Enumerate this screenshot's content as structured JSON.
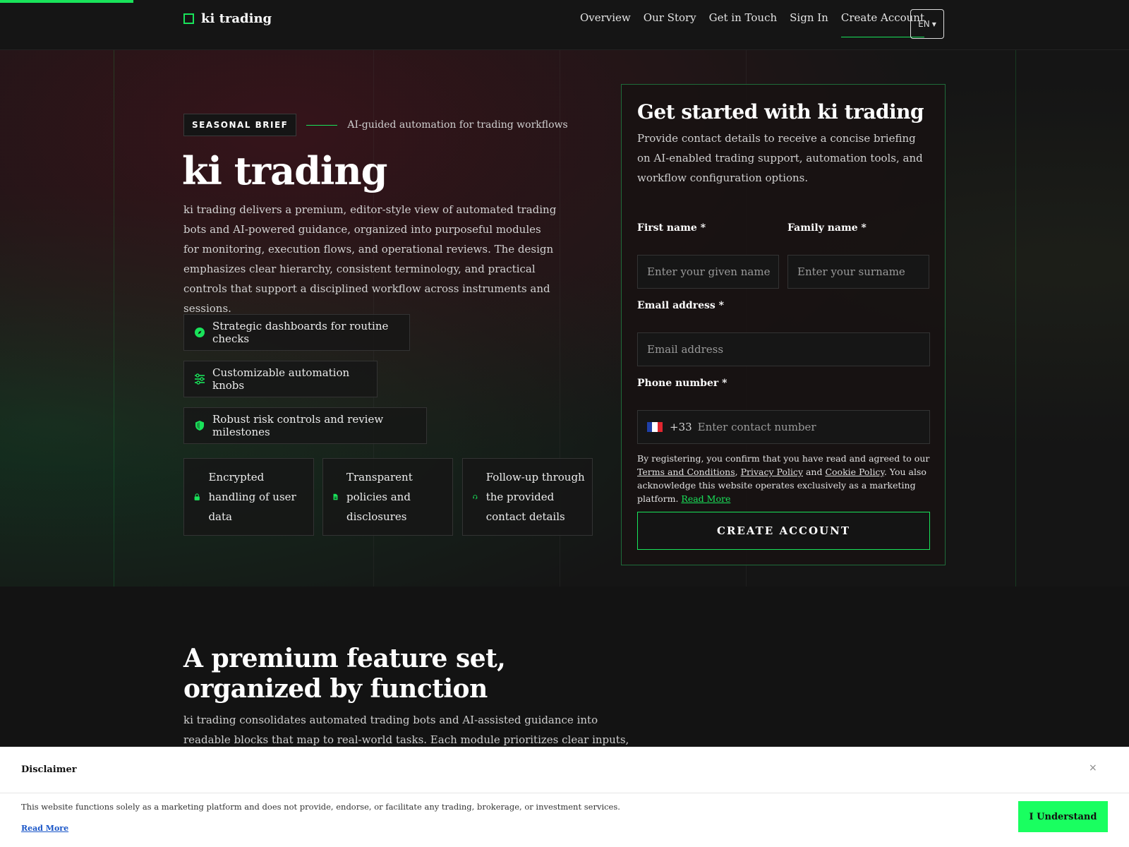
{
  "progress": {
    "value": 0.118
  },
  "header": {
    "brand": "ki trading",
    "nav": [
      "Overview",
      "Our Story",
      "Get in Touch",
      "Sign In",
      "Create Account"
    ],
    "language": "EN"
  },
  "hero": {
    "tag": "SEASONAL BRIEF",
    "tagline": "AI-guided automation for trading workflows",
    "title": "ki trading",
    "description": "ki trading delivers a premium, editor-style view of automated trading bots and AI-powered guidance, organized into purposeful modules for monitoring, execution flows, and operational reviews. The design emphasizes clear hierarchy, consistent terminology, and practical controls that support a disciplined workflow across instruments and sessions.",
    "pills": [
      {
        "icon": "compass-icon",
        "label": "Strategic dashboards for routine checks"
      },
      {
        "icon": "sliders-icon",
        "label": "Customizable automation knobs"
      },
      {
        "icon": "shield-icon",
        "label": "Robust risk controls and review milestones"
      }
    ],
    "cards": [
      {
        "icon": "lock-icon",
        "label": "Encrypted handling of user data"
      },
      {
        "icon": "document-icon",
        "label": "Transparent policies and disclosures"
      },
      {
        "icon": "headset-icon",
        "label": "Follow-up through the provided contact details"
      }
    ]
  },
  "form": {
    "title": "Get started with ki trading",
    "description": "Provide contact details to receive a concise briefing on AI-enabled trading support, automation tools, and workflow configuration options.",
    "first_name_label": "First name *",
    "first_name_placeholder": "Enter your given name",
    "family_name_label": "Family name *",
    "family_name_placeholder": "Enter your surname",
    "email_label": "Email address *",
    "email_placeholder": "Email address",
    "phone_label": "Phone number *",
    "dial_code": "+33",
    "phone_placeholder": "Enter contact number",
    "legal_prefix": "By registering, you confirm that you have read and agreed to our ",
    "terms": "Terms and Conditions",
    "comma": ", ",
    "privacy": "Privacy Policy",
    "and": " and ",
    "cookie": "Cookie Policy",
    "legal_suffix": ". You also acknowledge this website operates exclusively as a marketing platform. ",
    "read_more": "Read More",
    "submit": "CREATE ACCOUNT"
  },
  "features": {
    "title": "A premium feature set, organized by function",
    "description": "ki trading consolidates automated trading bots and AI-assisted guidance into readable blocks that map to real-world tasks. Each module prioritizes clear inputs, repeatable routines, and"
  },
  "disclaimer": {
    "title": "Disclaimer",
    "close": "×",
    "text": "This website functions solely as a marketing platform and does not provide, endorse, or facilitate any trading, brokerage, or investment services.",
    "read_more": "Read More",
    "button": "I Understand"
  },
  "colors": {
    "accent": "#19e35a",
    "flag_blue": "#1f3fa8",
    "flag_white": "#ffffff",
    "flag_red": "#e0262f"
  }
}
